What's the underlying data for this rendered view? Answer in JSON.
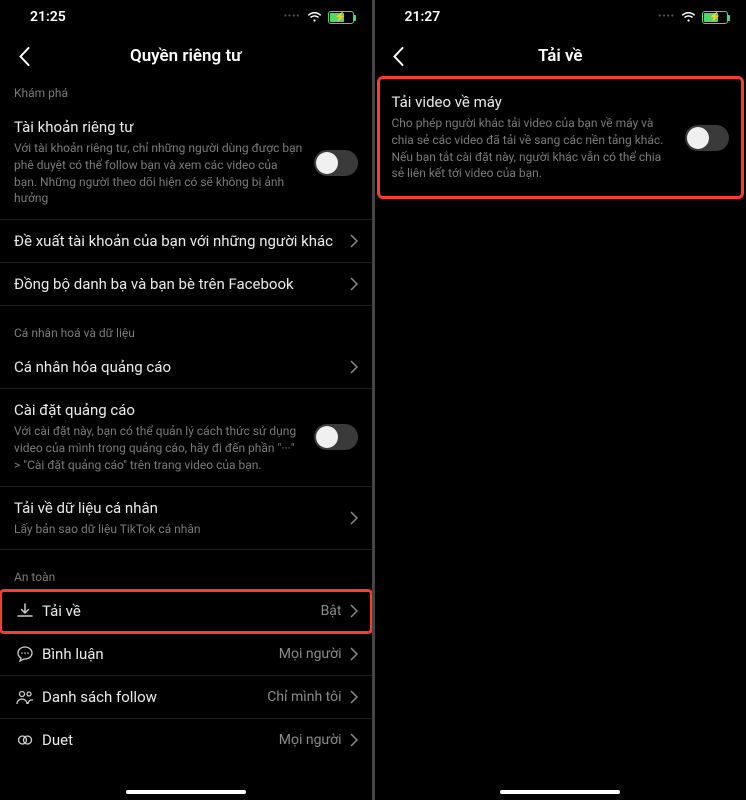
{
  "left": {
    "time": "21:25",
    "title": "Quyền riêng tư",
    "sections": {
      "discovery": {
        "header": "Khám phá",
        "private_account": {
          "label": "Tài khoản riêng tư",
          "desc": "Với tài khoản riêng tư, chỉ những người dùng được bạn phê duyệt có thể follow bạn và xem các video của bạn. Những người theo dõi hiện có sẽ không bị ảnh hưởng"
        },
        "suggest": {
          "label": "Đề xuất tài khoản của bạn với những người khác"
        },
        "sync": {
          "label": "Đồng bộ danh bạ và bạn bè trên Facebook"
        }
      },
      "personal": {
        "header": "Cá nhân hoá và dữ liệu",
        "ad_personal": {
          "label": "Cá nhân hóa quảng cáo"
        },
        "ad_settings": {
          "label": "Cài đặt quảng cáo",
          "desc": "Với cài đặt này, bạn có thể quản lý cách thức sử dụng video của mình trong quảng cáo, hãy đi đến phần \"···\" > \"Cài đặt quảng cáo\" trên trang video của bạn."
        },
        "download_data": {
          "label": "Tải về dữ liệu cá nhân",
          "desc": "Lấy bản sao dữ liệu TikTok cá nhân"
        }
      },
      "safety": {
        "header": "An toàn",
        "download": {
          "label": "Tải về",
          "value": "Bật"
        },
        "comment": {
          "label": "Bình luận",
          "value": "Mọi người"
        },
        "follow_list": {
          "label": "Danh sách follow",
          "value": "Chỉ mình tôi"
        },
        "duet": {
          "label": "Duet",
          "value": "Mọi người"
        }
      }
    }
  },
  "right": {
    "time": "21:27",
    "title": "Tải về",
    "download_video": {
      "label": "Tải video về máy",
      "desc": "Cho phép người khác tải video của bạn về máy và chia sẻ các video đã tải về sang các nền tảng khác. Nếu bạn tắt cài đặt này, người khác vẫn có thể chia sẻ liên kết tới video của bạn."
    }
  }
}
